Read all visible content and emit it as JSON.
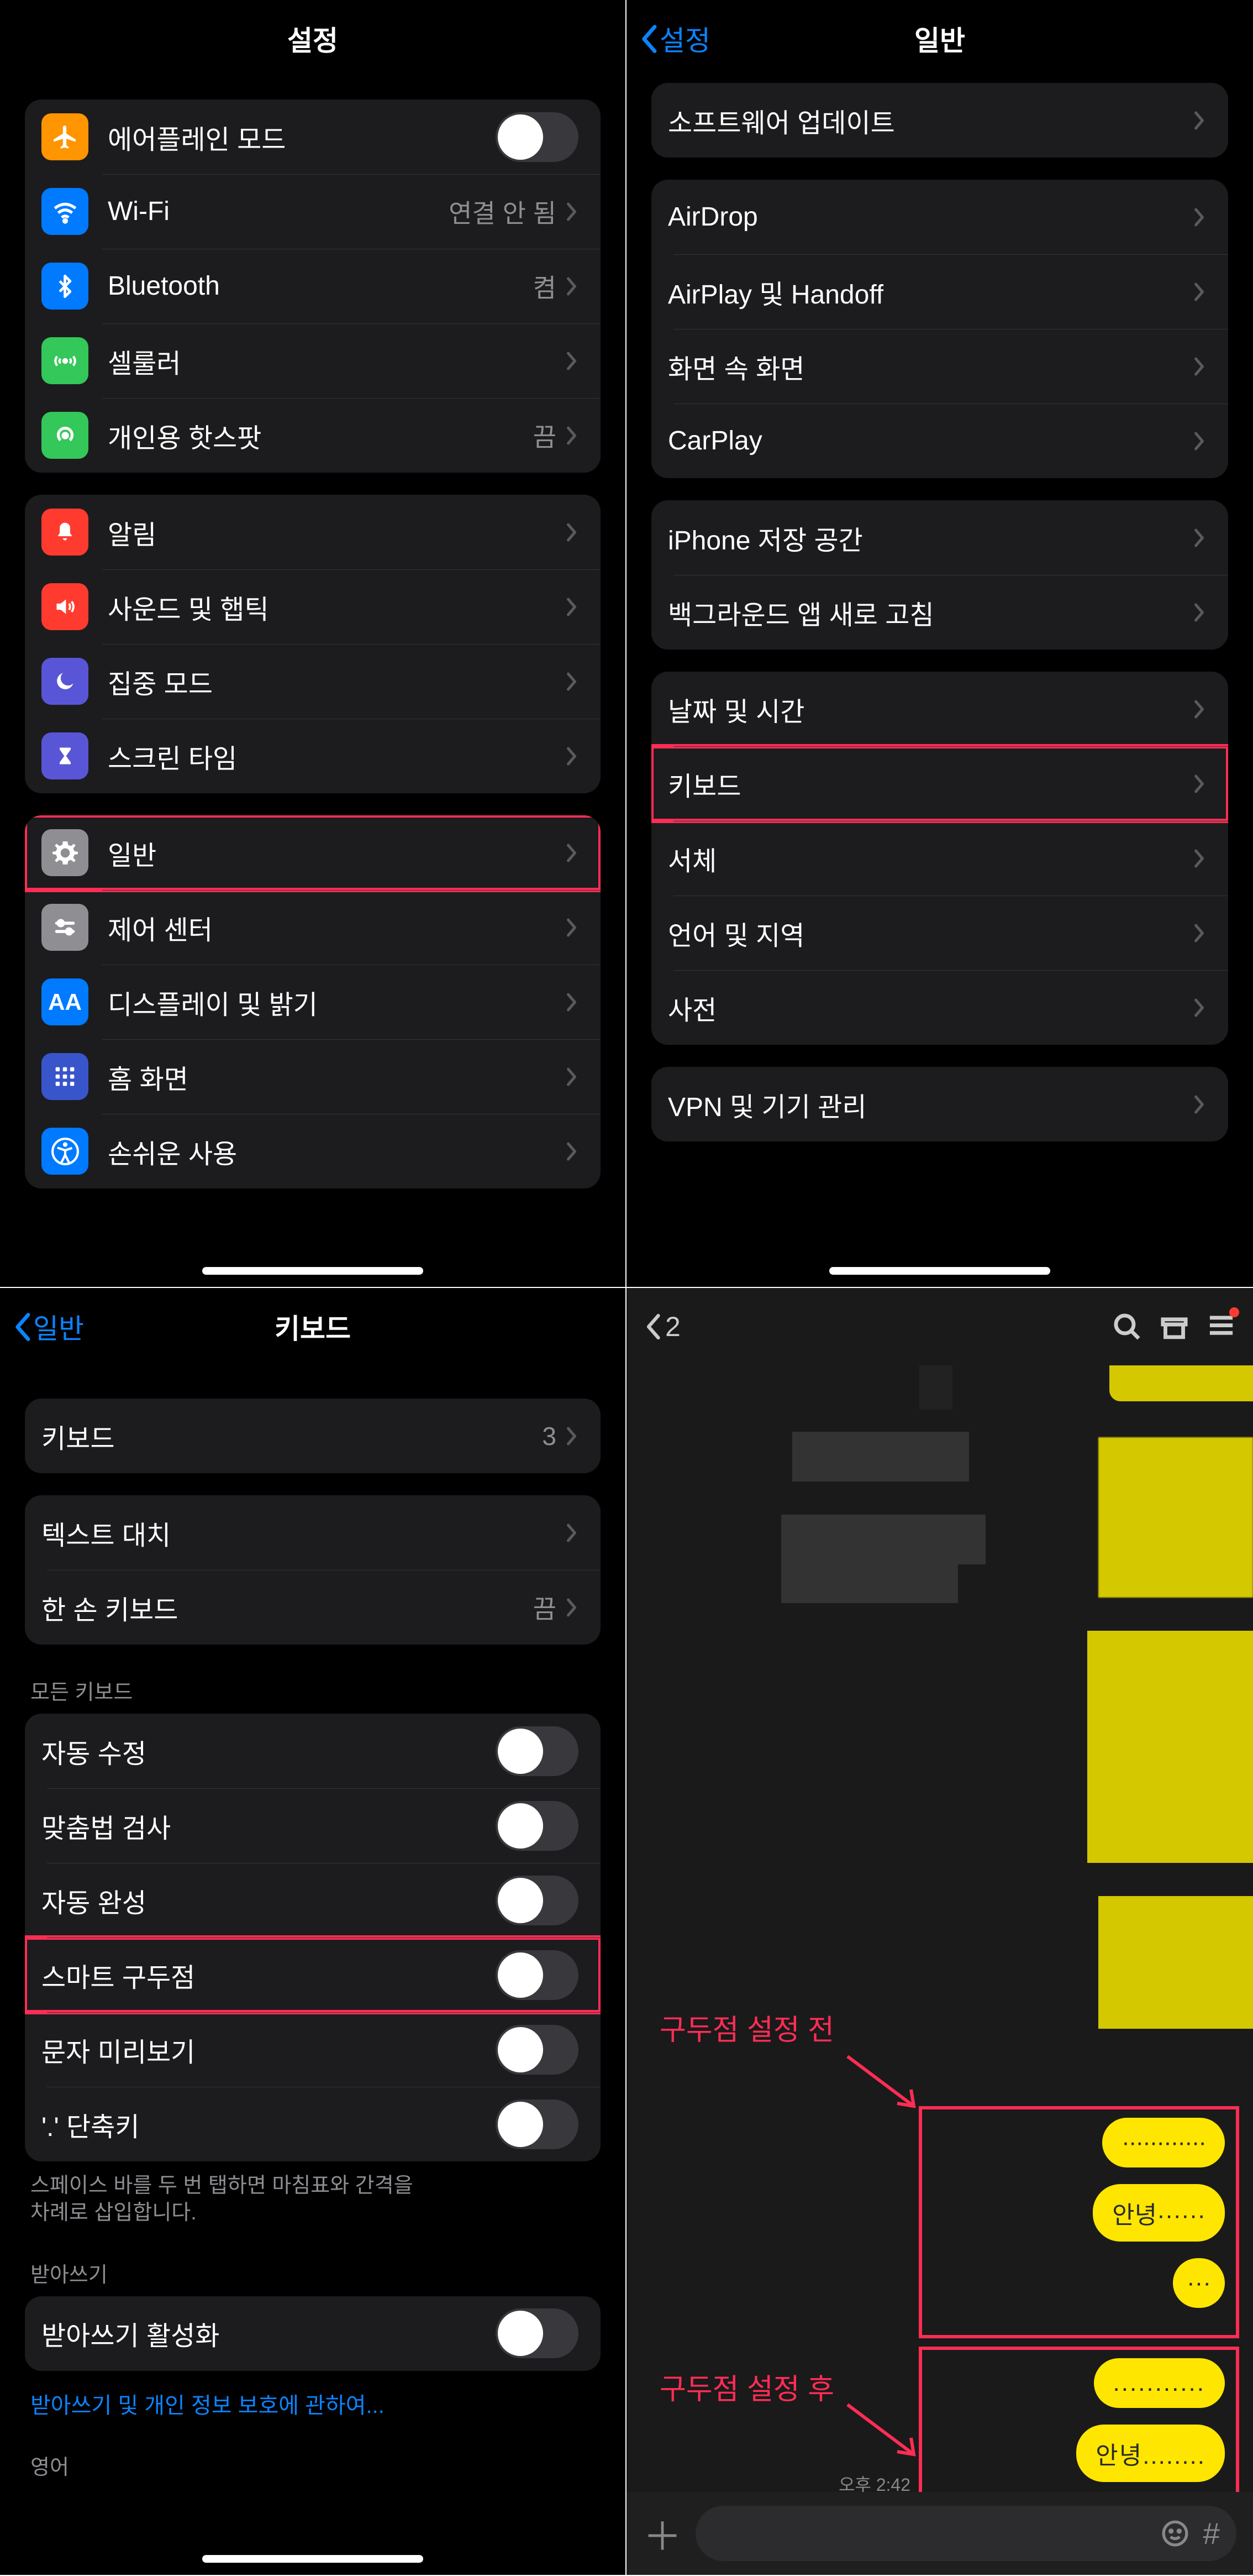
{
  "panel1": {
    "title": "설정",
    "group1": [
      {
        "icon": "airplane",
        "iconBg": "#ff9500",
        "label": "에어플레인 모드",
        "type": "toggle",
        "on": false
      },
      {
        "icon": "wifi",
        "iconBg": "#007aff",
        "label": "Wi-Fi",
        "type": "detail",
        "detail": "연결 안 됨"
      },
      {
        "icon": "bluetooth",
        "iconBg": "#007aff",
        "label": "Bluetooth",
        "type": "detail",
        "detail": "켬"
      },
      {
        "icon": "cellular",
        "iconBg": "#34c759",
        "label": "셀룰러",
        "type": "chev"
      },
      {
        "icon": "hotspot",
        "iconBg": "#34c759",
        "label": "개인용 핫스팟",
        "type": "detail",
        "detail": "끔"
      }
    ],
    "group2": [
      {
        "icon": "bell",
        "iconBg": "#ff3b30",
        "label": "알림",
        "type": "chev"
      },
      {
        "icon": "sound",
        "iconBg": "#ff3b30",
        "label": "사운드 및 햅틱",
        "type": "chev"
      },
      {
        "icon": "moon",
        "iconBg": "#5856d6",
        "label": "집중 모드",
        "type": "chev"
      },
      {
        "icon": "hourglass",
        "iconBg": "#5856d6",
        "label": "스크린 타임",
        "type": "chev"
      }
    ],
    "group3": [
      {
        "icon": "gear",
        "iconBg": "#8e8e93",
        "label": "일반",
        "type": "chev",
        "highlight": true
      },
      {
        "icon": "switches",
        "iconBg": "#8e8e93",
        "label": "제어 센터",
        "type": "chev"
      },
      {
        "icon": "aa",
        "iconBg": "#007aff",
        "label": "디스플레이 및 밝기",
        "type": "chev"
      },
      {
        "icon": "grid",
        "iconBg": "#3955cc",
        "label": "홈 화면",
        "type": "chev"
      },
      {
        "icon": "accessibility",
        "iconBg": "#007aff",
        "label": "손쉬운 사용",
        "type": "chev"
      }
    ]
  },
  "panel2": {
    "back": "설정",
    "title": "일반",
    "group1": [
      {
        "label": "소프트웨어 업데이트",
        "type": "chev"
      }
    ],
    "group2": [
      {
        "label": "AirDrop",
        "type": "chev"
      },
      {
        "label": "AirPlay 및 Handoff",
        "type": "chev"
      },
      {
        "label": "화면 속 화면",
        "type": "chev"
      },
      {
        "label": "CarPlay",
        "type": "chev"
      }
    ],
    "group3": [
      {
        "label": "iPhone 저장 공간",
        "type": "chev"
      },
      {
        "label": "백그라운드 앱 새로 고침",
        "type": "chev"
      }
    ],
    "group4": [
      {
        "label": "날짜 및 시간",
        "type": "chev"
      },
      {
        "label": "키보드",
        "type": "chev",
        "highlight": true
      },
      {
        "label": "서체",
        "type": "chev"
      },
      {
        "label": "언어 및 지역",
        "type": "chev"
      },
      {
        "label": "사전",
        "type": "chev"
      }
    ],
    "group5": [
      {
        "label": "VPN 및 기기 관리",
        "type": "chev"
      }
    ]
  },
  "panel3": {
    "back": "일반",
    "title": "키보드",
    "group1": [
      {
        "label": "키보드",
        "type": "detail",
        "detail": "3"
      }
    ],
    "group2": [
      {
        "label": "텍스트 대치",
        "type": "chev"
      },
      {
        "label": "한 손 키보드",
        "type": "detail",
        "detail": "끔"
      }
    ],
    "section1_label": "모든 키보드",
    "group3": [
      {
        "label": "자동 수정",
        "type": "toggle"
      },
      {
        "label": "맞춤법 검사",
        "type": "toggle"
      },
      {
        "label": "자동 완성",
        "type": "toggle"
      },
      {
        "label": "스마트 구두점",
        "type": "toggle",
        "highlight": true
      },
      {
        "label": "문자 미리보기",
        "type": "toggle"
      },
      {
        "label": "'.' 단축키",
        "type": "toggle"
      }
    ],
    "footer1": "스페이스 바를 두 번 탭하면 마침표와 간격을\n차례로 삽입합니다.",
    "section2_label": "받아쓰기",
    "group4": [
      {
        "label": "받아쓰기 활성화",
        "type": "toggle"
      }
    ],
    "link": "받아쓰기 및 개인 정보 보호에 관하여...",
    "section3_label": "영어"
  },
  "panel4": {
    "back_count": "2",
    "anno_before": "구두점 설정 전",
    "anno_after": "구두점 설정 후",
    "bubbles_before": [
      "············",
      "안녕······",
      "···"
    ],
    "bubbles_after": [
      "...........",
      "안녕........"
    ],
    "time": "오후 2:42",
    "hash": "#"
  }
}
